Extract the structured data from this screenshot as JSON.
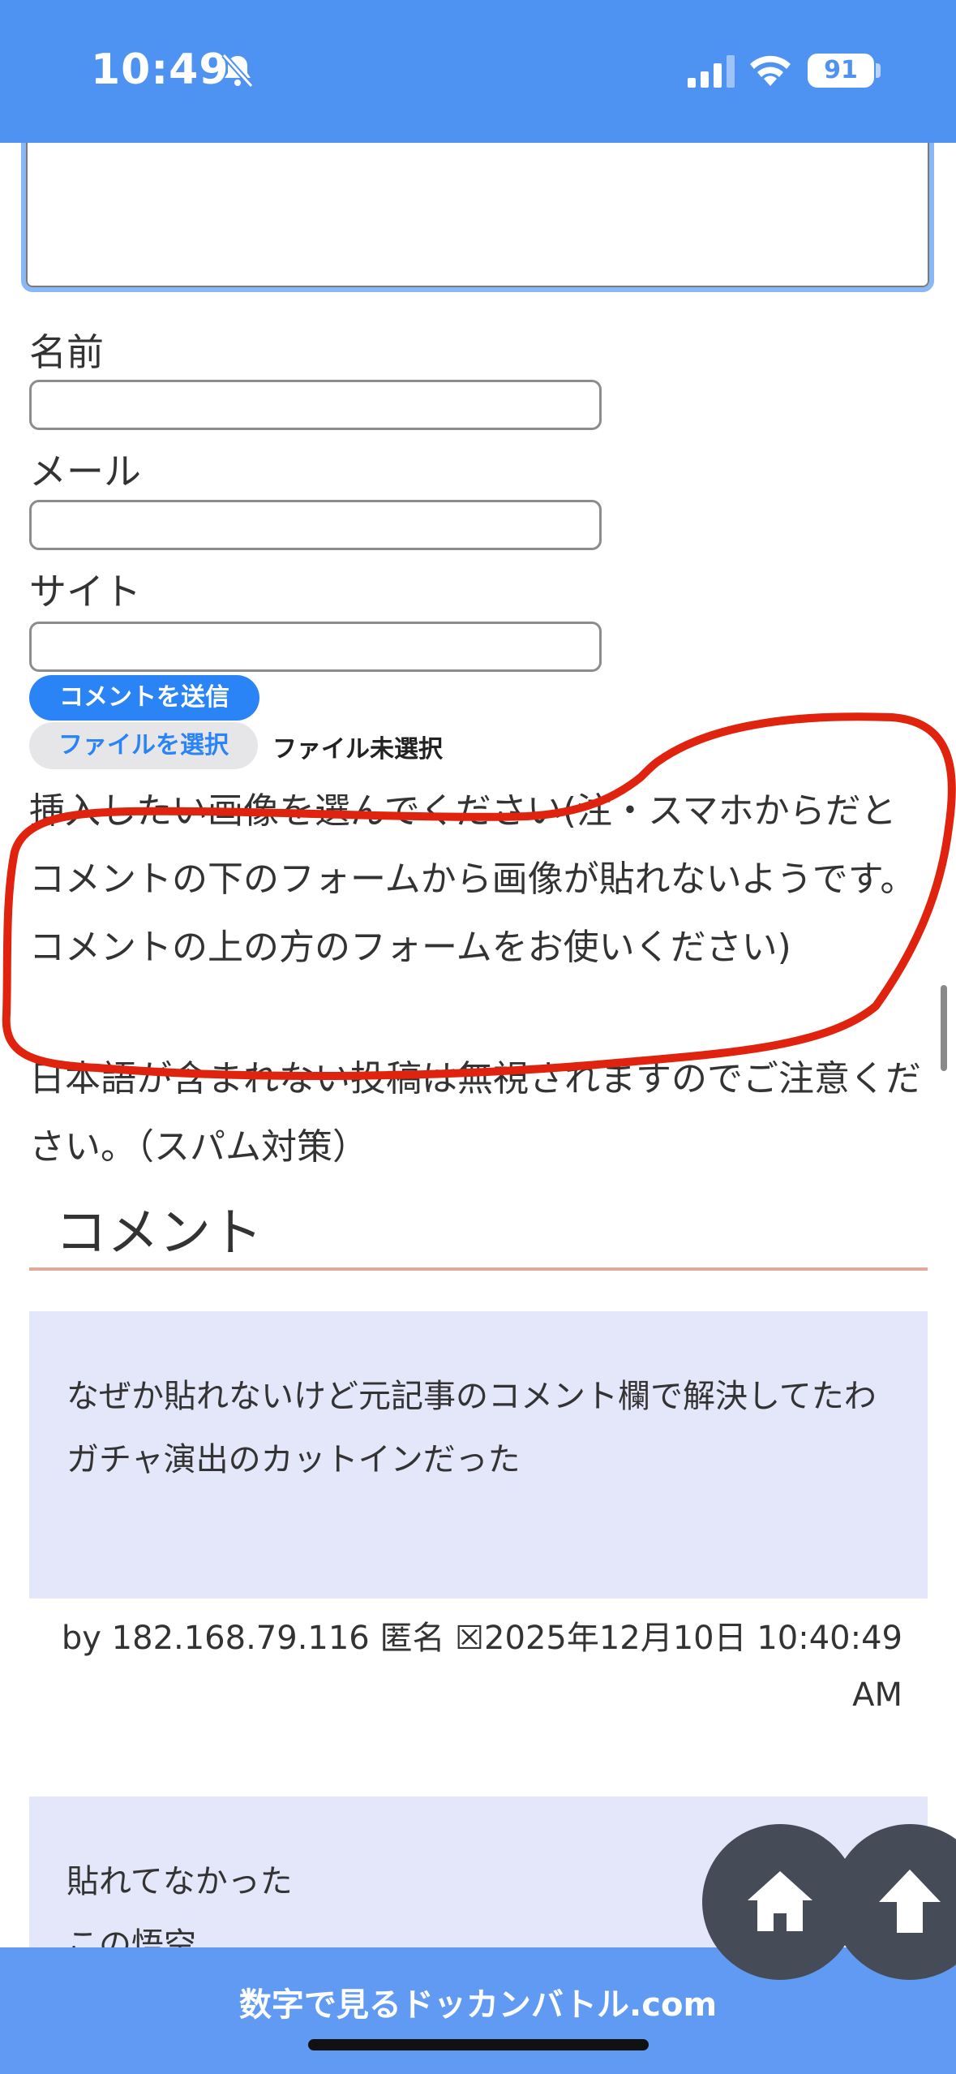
{
  "status_bar": {
    "time": "10:49",
    "battery": "91",
    "icons": [
      "bell-slash-icon",
      "signal-icon",
      "wifi-icon",
      "battery-icon"
    ]
  },
  "form": {
    "name_label": "名前",
    "mail_label": "メール",
    "site_label": "サイト",
    "submit_label": "コメントを送信",
    "file_button_label": "ファイルを選択",
    "file_status": "ファイル未選択",
    "image_notice": "挿入したい画像を選んでください(注・スマホからだとコメントの下のフォームから画像が貼れないようです。コメントの上の方のフォームをお使いください)",
    "spam_notice": "日本語が含まれない投稿は無視されますのでご注意ください。（スパム対策）"
  },
  "comments_section": {
    "title": "コメント",
    "comments": [
      {
        "text": "なぜか貼れないけど元記事のコメント欄で解決してたわ\nガチャ演出のカットインだった",
        "meta": "by 182.168.79.116 匿名 ☒2025年12月10日 10:40:49 AM"
      },
      {
        "text": "貼れてなかった\nこの悟空",
        "meta": ""
      }
    ]
  },
  "fabs": {
    "home_icon": "home-icon",
    "up_icon": "arrow-up-icon"
  },
  "footer": {
    "site_name": "数字で見るドッカンバトル.com"
  },
  "colors": {
    "header_blue": "#4f93f2",
    "footer_blue": "#609af2",
    "highlight_red": "#e0230e",
    "comment_bg": "#e4e6fa",
    "button_blue": "#2a84f5"
  }
}
